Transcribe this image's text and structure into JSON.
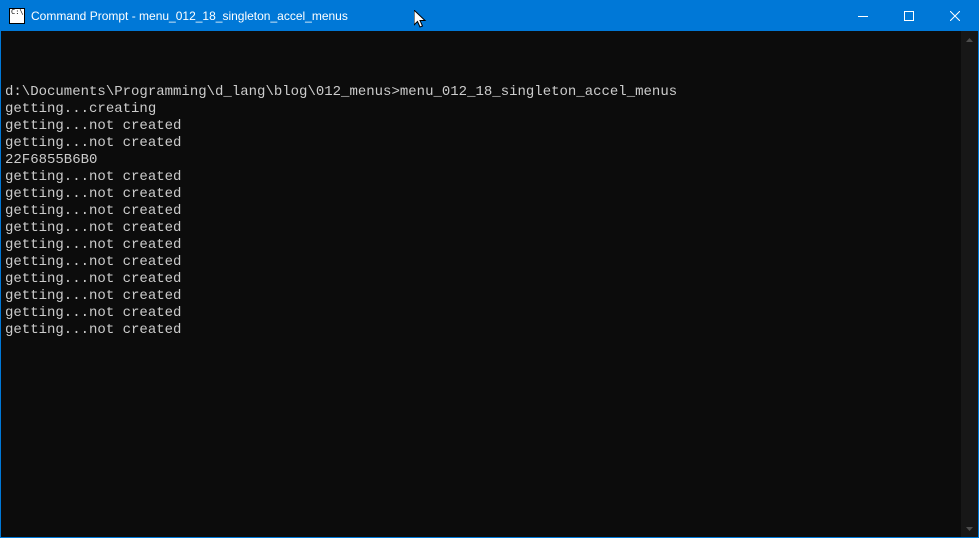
{
  "window": {
    "title": "Command Prompt - menu_012_18_singleton_accel_menus"
  },
  "terminal": {
    "prompt_path": "d:\\Documents\\Programming\\d_lang\\blog\\012_menus>",
    "command": "menu_012_18_singleton_accel_menus",
    "output_lines": [
      "getting...creating",
      "getting...not created",
      "getting...not created",
      "22F6855B6B0",
      "getting...not created",
      "getting...not created",
      "getting...not created",
      "getting...not created",
      "getting...not created",
      "getting...not created",
      "getting...not created",
      "getting...not created",
      "getting...not created",
      "getting...not created"
    ]
  }
}
